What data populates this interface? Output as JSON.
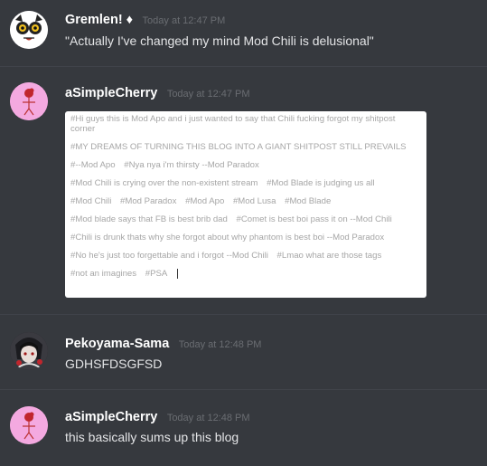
{
  "messages": [
    {
      "author": "Gremlen! ♦",
      "timestamp": "Today at 12:47 PM",
      "text": "\"Actually I've changed my mind Mod Chili is delusional\""
    },
    {
      "author": "aSimpleCherry",
      "timestamp": "Today at 12:47 PM",
      "embed_tag_lines": [
        [
          "#Hi guys this is Mod Apo and i just wanted to say that Chili fucking forgot my shitpost corner"
        ],
        [
          "#MY DREAMS OF TURNING THIS BLOG INTO A GIANT SHITPOST STILL PREVAILS"
        ],
        [
          "#--Mod Apo",
          "#Nya nya i'm thirsty --Mod Paradox"
        ],
        [
          "#Mod Chili is crying over the non-existent stream",
          "#Mod Blade is judging us all"
        ],
        [
          "#Mod Chili",
          "#Mod Paradox",
          "#Mod Apo",
          "#Mod Lusa",
          "#Mod Blade"
        ],
        [
          "#Mod blade says that FB is best brib dad",
          "#Comet is best boi pass it on --Mod Chili"
        ],
        [
          "#Chili is drunk thats why she forgot about why phantom is best boi --Mod Paradox"
        ],
        [
          "#No he's just too forgettable and i forgot --Mod Chili",
          "#Lmao what are those tags"
        ],
        [
          "#not an imagines",
          "#PSA"
        ]
      ]
    },
    {
      "author": "Pekoyama-Sama",
      "timestamp": "Today at 12:48 PM",
      "text": "GDHSFDSGFSD"
    },
    {
      "author": "aSimpleCherry",
      "timestamp": "Today at 12:48 PM",
      "text": "this basically sums up this blog"
    }
  ],
  "colors": {
    "background": "#36393e",
    "author": "#ffffff",
    "timestamp": "#6a6d72",
    "text": "#dcddde",
    "cherry_avatar_bg": "#f4a9e0"
  },
  "icons": {
    "gremlen_avatar": "owl-face-icon",
    "cherry_avatar": "cherry-stick-figure-icon",
    "pekoyama_avatar": "anime-character-icon"
  }
}
